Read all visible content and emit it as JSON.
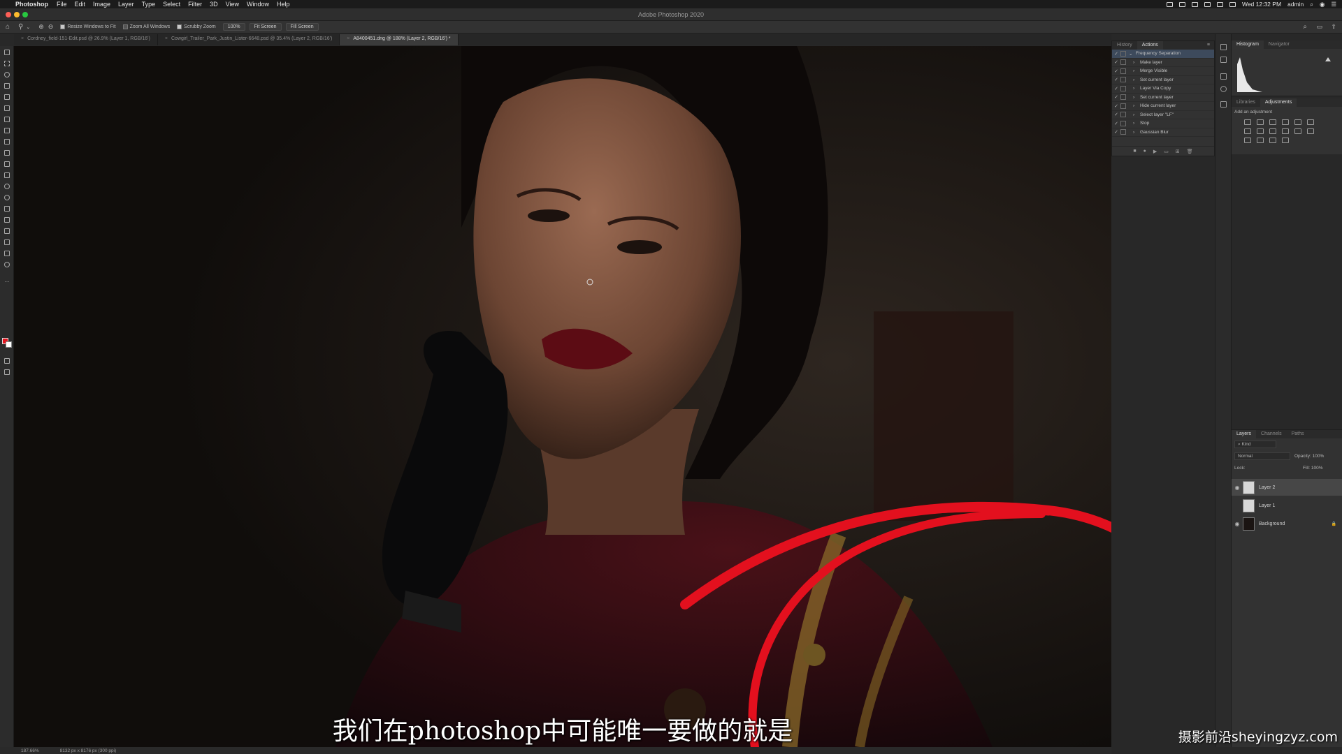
{
  "menubar": {
    "app_name": "Photoshop",
    "items": [
      "File",
      "Edit",
      "Image",
      "Layer",
      "Type",
      "Select",
      "Filter",
      "3D",
      "View",
      "Window",
      "Help"
    ],
    "clock": "Wed 12:32 PM",
    "user": "admin"
  },
  "window": {
    "title": "Adobe Photoshop 2020"
  },
  "options": {
    "resize_windows": "Resize Windows to Fit",
    "zoom_all": "Zoom All Windows",
    "scrubby_zoom": "Scrubby Zoom",
    "zoom_percent": "100%",
    "fit_screen": "Fit Screen",
    "fill_screen": "Fill Screen"
  },
  "tabs": [
    {
      "label": "Cordney_field-151-Edit.psd @ 26.9% (Layer 1, RGB/16')"
    },
    {
      "label": "Cowgirl_Trailer_Park_Justin_Lister-6648.psd @ 35.4% (Layer 2, RGB/16')"
    },
    {
      "label": "A8400451.dng @ 188% (Layer 2, RGB/16') *"
    }
  ],
  "subtitle": "我们在photoshop中可能唯一要做的就是",
  "watermark": "摄影前沿sheyingzyz.com",
  "statusbar": {
    "zoom": "187.66%",
    "doc_info": "8132 px x 8176 px (300 ppi)"
  },
  "actions_panel": {
    "tabs": [
      "History",
      "Actions"
    ],
    "rows": [
      {
        "label": "Frequency Separation",
        "level": 0
      },
      {
        "label": "Make layer",
        "level": 1
      },
      {
        "label": "Merge Visible",
        "level": 1
      },
      {
        "label": "Set current layer",
        "level": 1
      },
      {
        "label": "Layer Via Copy",
        "level": 1
      },
      {
        "label": "Set current layer",
        "level": 1
      },
      {
        "label": "Hide current layer",
        "level": 1
      },
      {
        "label": "Select layer \"LF\"",
        "level": 1
      },
      {
        "label": "Stop",
        "level": 1
      },
      {
        "label": "Gaussian Blur",
        "level": 1
      }
    ]
  },
  "histogram_panel": {
    "tabs": [
      "Histogram",
      "Navigator"
    ]
  },
  "adjustments_panel": {
    "tabs": [
      "Libraries",
      "Adjustments"
    ],
    "hint": "Add an adjustment"
  },
  "layers_panel": {
    "tabs": [
      "Layers",
      "Channels",
      "Paths"
    ],
    "kind": "Kind",
    "blend_mode": "Normal",
    "opacity_label": "Opacity:",
    "opacity": "100%",
    "lock_label": "Lock:",
    "fill_label": "Fill:",
    "fill": "100%",
    "layers": [
      {
        "name": "Layer 2",
        "visible": true,
        "selected": true
      },
      {
        "name": "Layer 1",
        "visible": false,
        "selected": false
      },
      {
        "name": "Background",
        "visible": true,
        "selected": false
      }
    ]
  },
  "colors": {
    "foreground": "#e4141e",
    "background": "#ffffff",
    "annotation_stroke": "#e3101e"
  }
}
